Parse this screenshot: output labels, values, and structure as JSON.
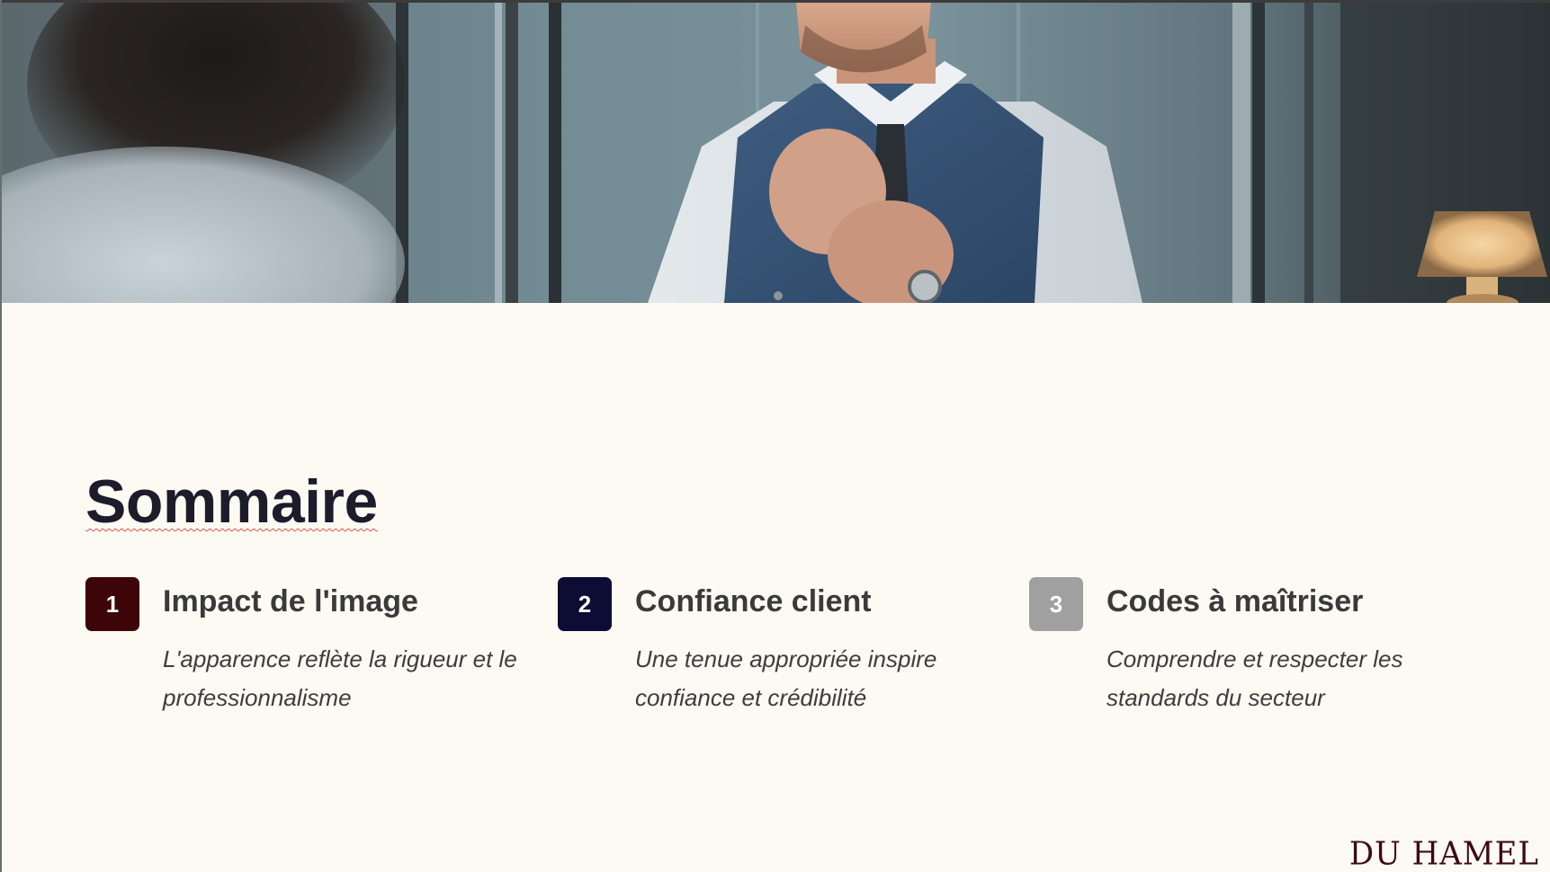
{
  "slide": {
    "hero_image": "man-adjusting-tie-in-suit-vest-mirror-photo",
    "title": "Sommaire",
    "items": [
      {
        "number": "1",
        "title": "Impact de l'image",
        "description": "L'apparence reflète la rigueur et le professionnalisme",
        "badge_color": "#3d0508"
      },
      {
        "number": "2",
        "title": "Confiance client",
        "description": "Une tenue appropriée inspire confiance et crédibilité",
        "badge_color": "#0d0c35"
      },
      {
        "number": "3",
        "title": "Codes à maîtriser",
        "description": "Comprendre et respecter les standards du secteur",
        "badge_color": "#a0a0a0"
      }
    ],
    "logo": "DU HAMEL"
  },
  "colors": {
    "background": "#fdfaf3",
    "title": "#1c1c2b",
    "logo": "#3d0b12"
  }
}
